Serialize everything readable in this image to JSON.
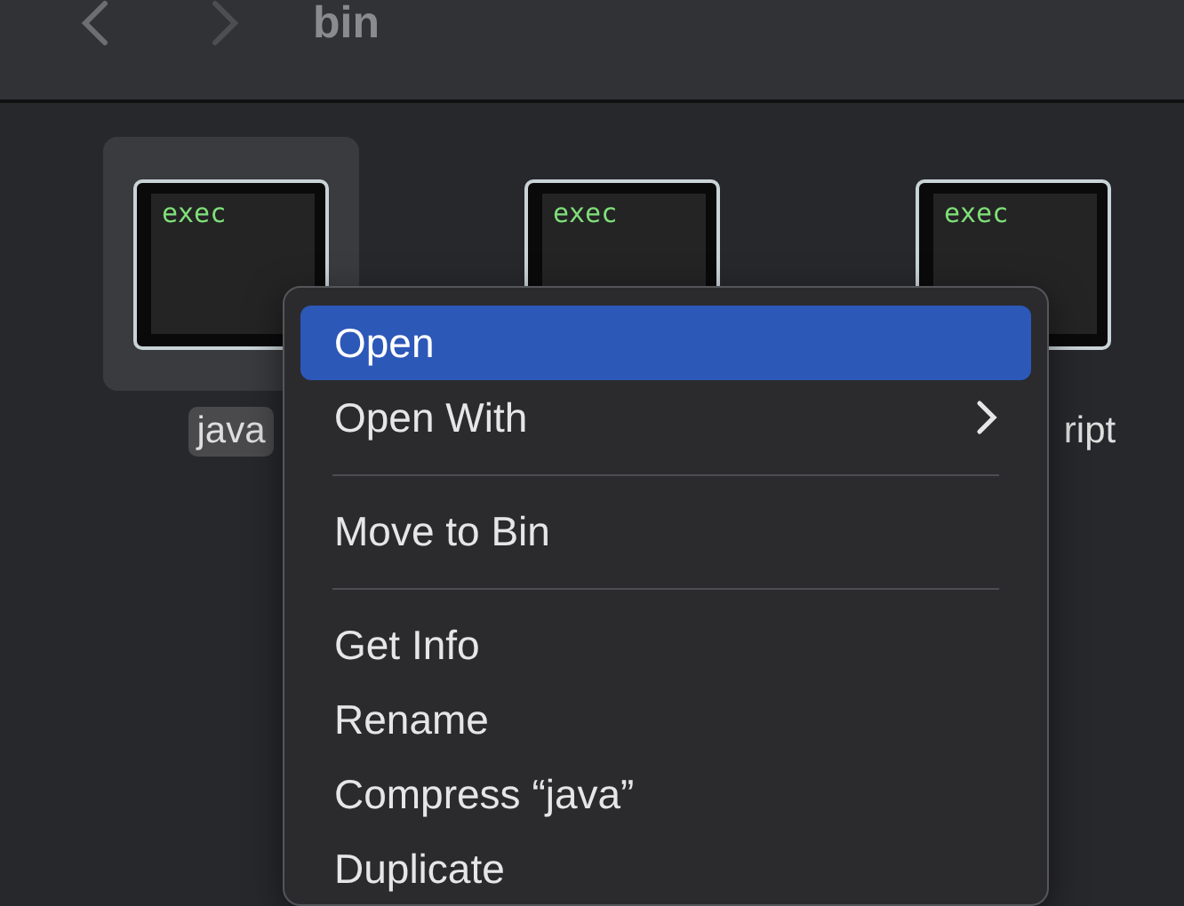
{
  "toolbar": {
    "title": "bin"
  },
  "files": [
    {
      "icon_text": "exec",
      "label": "java",
      "selected": true
    },
    {
      "icon_text": "exec",
      "selected": false
    },
    {
      "icon_text": "exec",
      "label": "ript",
      "selected": false
    }
  ],
  "context_menu": {
    "items": [
      {
        "kind": "item",
        "label": "Open",
        "selected": true,
        "submenu": false
      },
      {
        "kind": "item",
        "label": "Open With",
        "selected": false,
        "submenu": true
      },
      {
        "kind": "separator"
      },
      {
        "kind": "item",
        "label": "Move to Bin",
        "selected": false,
        "submenu": false
      },
      {
        "kind": "separator"
      },
      {
        "kind": "item",
        "label": "Get Info",
        "selected": false,
        "submenu": false
      },
      {
        "kind": "item",
        "label": "Rename",
        "selected": false,
        "submenu": false
      },
      {
        "kind": "item",
        "label": "Compress “java”",
        "selected": false,
        "submenu": false
      },
      {
        "kind": "item",
        "label": "Duplicate",
        "selected": false,
        "submenu": false
      }
    ]
  }
}
